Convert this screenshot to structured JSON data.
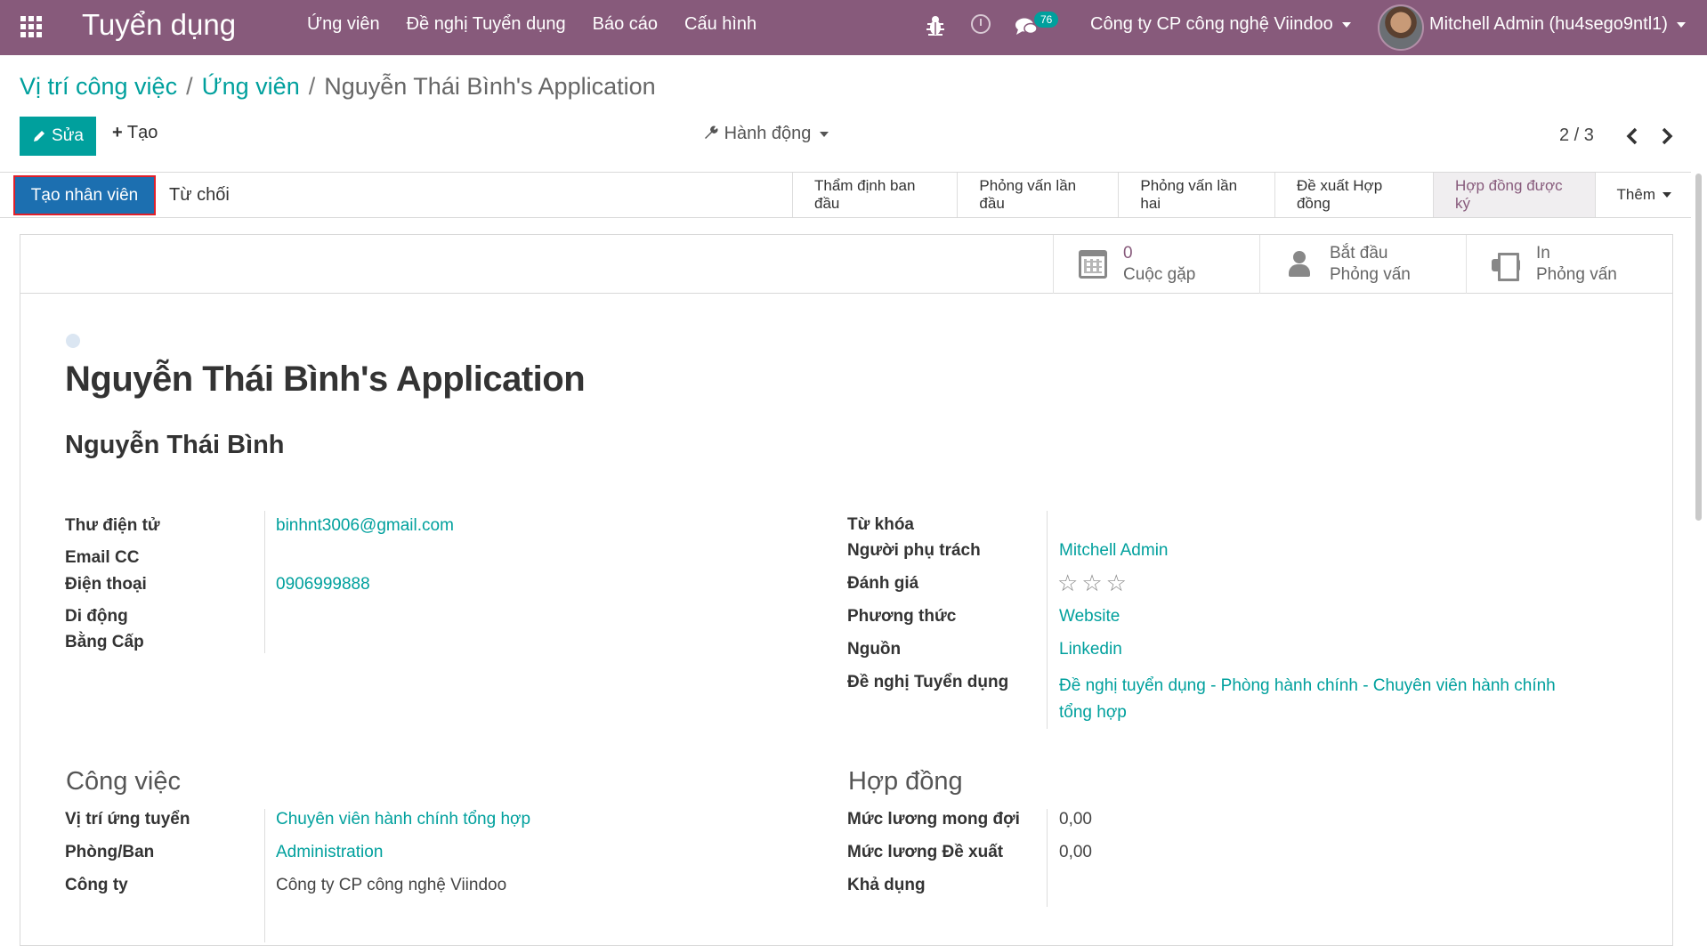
{
  "navbar": {
    "app_title": "Tuyển dụng",
    "menu": [
      "Ứng viên",
      "Đề nghị Tuyển dụng",
      "Báo cáo",
      "Cấu hình"
    ],
    "message_count": "76",
    "company": "Công ty CP công nghệ Viindoo",
    "user": "Mitchell Admin (hu4sego9ntl1)"
  },
  "breadcrumb": {
    "items": [
      "Vị trí công việc",
      "Ứng viên"
    ],
    "current": "Nguyễn Thái Bình's Application"
  },
  "controls": {
    "edit_label": "Sửa",
    "create_label": "Tạo",
    "action_label": "Hành động",
    "pager": "2 / 3"
  },
  "statusbar": {
    "hire_label": "Tạo nhân viên",
    "refuse_label": "Từ chối",
    "stages": [
      "Thẩm định ban đầu",
      "Phỏng vấn lần đầu",
      "Phỏng vấn lần hai",
      "Đề xuất Hợp đồng",
      "Hợp đồng được ký"
    ],
    "active_stage": "Hợp đồng được ký",
    "more_label": "Thêm"
  },
  "smart_buttons": {
    "meetings": {
      "count": "0",
      "label": "Cuộc gặp"
    },
    "start_interview": {
      "line1": "Bắt đầu",
      "line2": "Phỏng vấn"
    },
    "print_interview": {
      "line1": "In",
      "line2": "Phỏng vấn"
    }
  },
  "record": {
    "title": "Nguyễn Thái Bình's Application",
    "partner_name": "Nguyễn Thái Bình"
  },
  "left_fields": {
    "email_label": "Thư điện tử",
    "email_value": "binhnt3006@gmail.com",
    "email_cc_label": "Email CC",
    "phone_label": "Điện thoại",
    "phone_value": "0906999888",
    "mobile_label": "Di động",
    "degree_label": "Bằng Cấp"
  },
  "right_fields": {
    "tags_label": "Từ khóa",
    "responsible_label": "Người phụ trách",
    "responsible_value": "Mitchell Admin",
    "rating_label": "Đánh giá",
    "rating_value": 0,
    "rating_max": 3,
    "medium_label": "Phương thức",
    "medium_value": "Website",
    "source_label": "Nguồn",
    "source_value": "Linkedin",
    "request_label": "Đề nghị Tuyển dụng",
    "request_value_line1": "Đề nghị tuyển dụng - Phòng hành chính - Chuyên viên hành chính",
    "request_value_line2": "tổng hợp"
  },
  "job_section": {
    "title": "Công việc",
    "position_label": "Vị trí ứng tuyển",
    "position_value": "Chuyên viên hành chính tổng hợp",
    "department_label": "Phòng/Ban",
    "department_value": "Administration",
    "company_label": "Công ty",
    "company_value": "Công ty CP công nghệ Viindoo"
  },
  "contract_section": {
    "title": "Hợp đồng",
    "expected_label": "Mức lương mong đợi",
    "expected_value": "0,00",
    "proposed_label": "Mức lương Đề xuất",
    "proposed_value": "0,00",
    "availability_label": "Khả dụng"
  }
}
